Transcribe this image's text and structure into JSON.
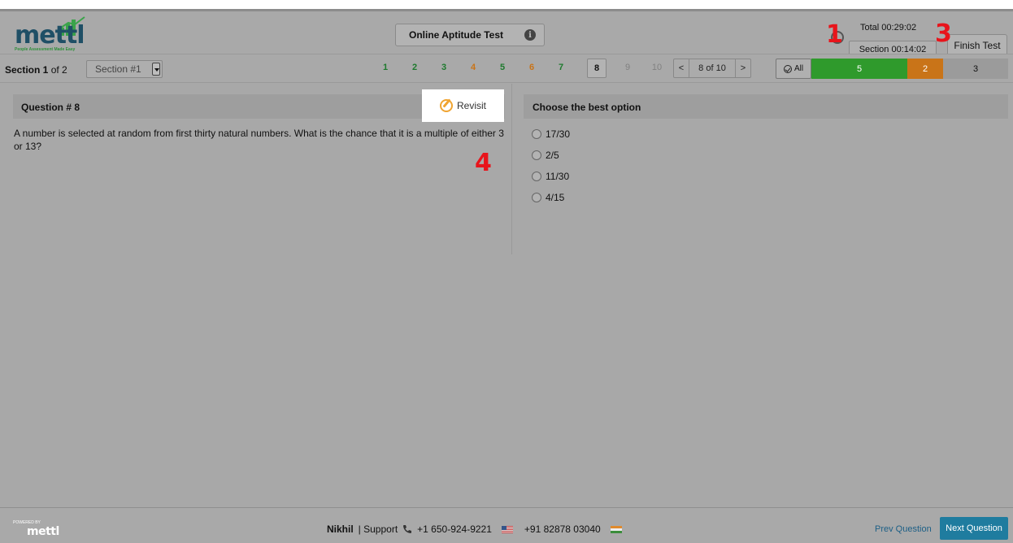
{
  "header": {
    "logo_text": "mettl",
    "logo_tagline": "People Assessment Made Easy",
    "title": "Online Aptitude Test",
    "info_icon": "info-icon",
    "timer_icon": "clock-icon",
    "total_time": "Total 00:29:02",
    "section_time": "Section 00:14:02",
    "finish_label": "Finish Test"
  },
  "markers": {
    "m1": "1",
    "m3": "3",
    "m4": "4"
  },
  "navbar": {
    "section_label_bold": "Section 1",
    "section_label_rest": " of 2",
    "section_select": "Section #1",
    "questions": [
      {
        "n": "1",
        "status": "answered"
      },
      {
        "n": "2",
        "status": "answered"
      },
      {
        "n": "3",
        "status": "answered"
      },
      {
        "n": "4",
        "status": "revisit"
      },
      {
        "n": "5",
        "status": "answered"
      },
      {
        "n": "6",
        "status": "revisit"
      },
      {
        "n": "7",
        "status": "answered"
      },
      {
        "n": "8",
        "status": "current"
      },
      {
        "n": "9",
        "status": "unseen"
      },
      {
        "n": "10",
        "status": "unseen"
      }
    ],
    "pager_prev": "<",
    "pager_label": "8 of 10",
    "pager_next": ">",
    "all_label": "All",
    "stats": {
      "answered": "5",
      "revisit": "2",
      "unanswered": "3"
    },
    "status_colors": {
      "answered": "#2f9a2c",
      "revisit": "#c97418",
      "unseen": "#9b9b9b",
      "accent": "#1f7c9f"
    }
  },
  "question": {
    "heading": "Question # 8",
    "revisit_label": "Revisit",
    "text": "A number is selected at random from first thirty natural numbers. What is the chance that it is a multiple of either 3 or 13?"
  },
  "options": {
    "heading": "Choose the best option",
    "items": [
      "17/30",
      "2/5",
      "11/30",
      "4/15"
    ]
  },
  "footer": {
    "powered_by": "POWERED BY",
    "logo_text": "mettl",
    "user": "Nikhil",
    "support_label": "| Support",
    "phone_us": "+1 650-924-9221",
    "phone_in": "+91 82878 03040",
    "prev_label": "Prev Question",
    "next_label": "Next Question"
  }
}
